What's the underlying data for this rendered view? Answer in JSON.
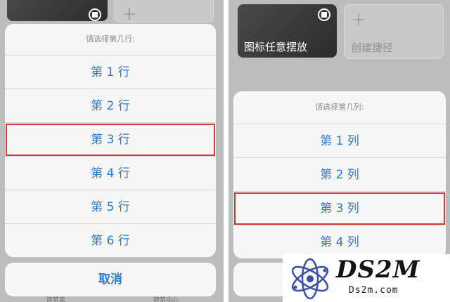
{
  "left_panel": {
    "sheet_title": "请选择第几行:",
    "rows": [
      "第 1 行",
      "第 2 行",
      "第 3 行",
      "第 4 行",
      "第 5 行",
      "第 6 行"
    ],
    "selected_row": "第 3 行",
    "cancel_label": "取消",
    "dock_labels": [
      "建筑库",
      "建筑中心"
    ]
  },
  "right_panel": {
    "tiles": {
      "arrange_label": "图标任意摆放",
      "create_label": "创建捷径"
    },
    "sheet_title": "请选择第几列:",
    "rows": [
      "第 1 列",
      "第 2 列",
      "第 3 列",
      "第 4 列"
    ],
    "selected_row": "第 3 列"
  },
  "colors": {
    "accent": "#3478c6",
    "highlight": "#d63a3a",
    "dim_background": "#bdbdbd"
  },
  "watermark": {
    "brand": "DS2M",
    "domain": "Ds2m.com"
  }
}
